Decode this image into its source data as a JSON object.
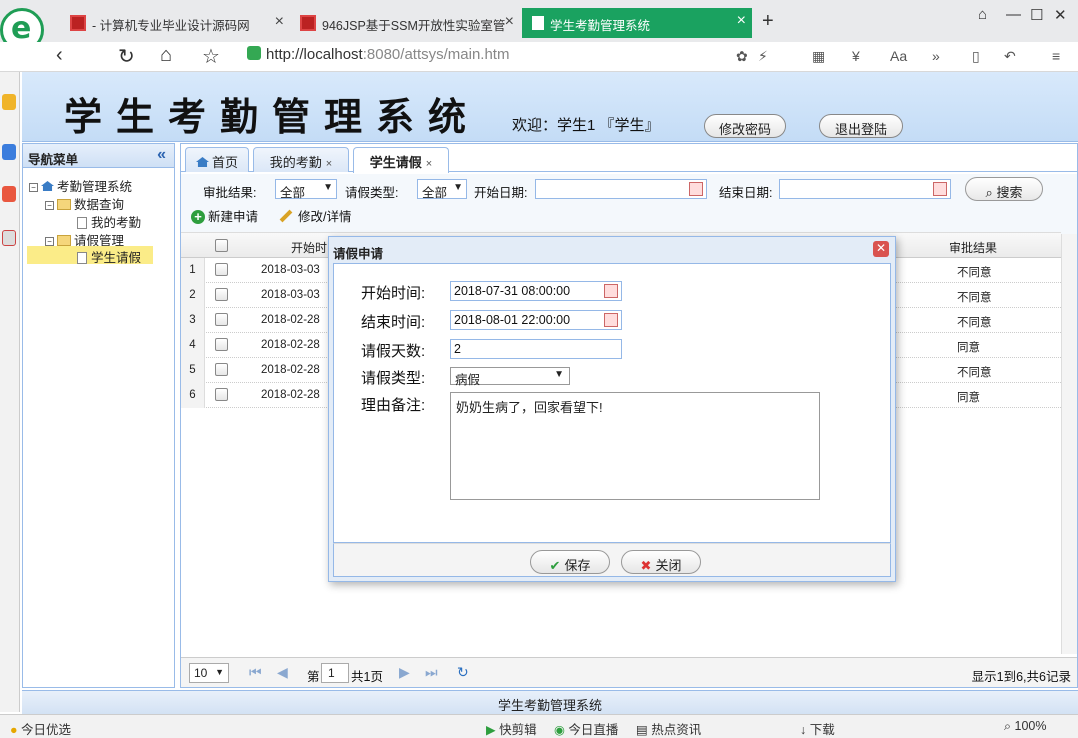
{
  "browser": {
    "tabs": [
      {
        "title": "- 计算机专业毕业设计源码网"
      },
      {
        "title": "946JSP基于SSM开放性实验室管"
      },
      {
        "title": "学生考勤管理系统"
      }
    ],
    "url_host": "http://localhost",
    "url_rest": ":8080/attsys/main.htm"
  },
  "header": {
    "title": "学生考勤管理系统",
    "welcome": "欢迎：学生1 『学生』",
    "change_password": "修改密码",
    "logout": "退出登陆"
  },
  "nav": {
    "title": "导航菜单",
    "root": "考勤管理系统",
    "group1": "数据查询",
    "item1": "我的考勤",
    "group2": "请假管理",
    "item2": "学生请假"
  },
  "tabs": [
    {
      "label": "首页"
    },
    {
      "label": "我的考勤"
    },
    {
      "label": "学生请假"
    }
  ],
  "search": {
    "status_label": "审批结果:",
    "status_value": "全部",
    "type_label": "请假类型:",
    "type_value": "全部",
    "start_label": "开始日期:",
    "end_label": "结束日期:",
    "search_btn": "搜索",
    "new_btn": "新建申请",
    "edit_btn": "修改/详情"
  },
  "grid": {
    "col_start": "开始时",
    "col_result": "审批结果",
    "rows": [
      {
        "num": "1",
        "start": "2018-03-03",
        "result": "不同意"
      },
      {
        "num": "2",
        "start": "2018-03-03",
        "result": "不同意"
      },
      {
        "num": "3",
        "start": "2018-02-28",
        "result": "不同意"
      },
      {
        "num": "4",
        "start": "2018-02-28",
        "result": "同意"
      },
      {
        "num": "5",
        "start": "2018-02-28",
        "result": "不同意"
      },
      {
        "num": "6",
        "start": "2018-02-28",
        "result": "同意"
      }
    ]
  },
  "pager": {
    "page_size": "10",
    "page_prefix": "第",
    "page_num": "1",
    "page_total": "共1页",
    "summary": "显示1到6,共6记录"
  },
  "dialog": {
    "title": "请假申请",
    "start_label": "开始时间:",
    "start_value": "2018-07-31 08:00:00",
    "end_label": "结束时间:",
    "end_value": "2018-08-01 22:00:00",
    "days_label": "请假天数:",
    "days_value": "2",
    "type_label": "请假类型:",
    "type_value": "病假",
    "reason_label": "理由备注:",
    "reason_value": "奶奶生病了，回家看望下!",
    "save": "保存",
    "close": "关闭"
  },
  "footer": "学生考勤管理系统",
  "statusbar": {
    "left": "今日优选",
    "items": [
      "快剪辑",
      "今日直播",
      "热点资讯",
      "下载",
      "100%"
    ]
  }
}
